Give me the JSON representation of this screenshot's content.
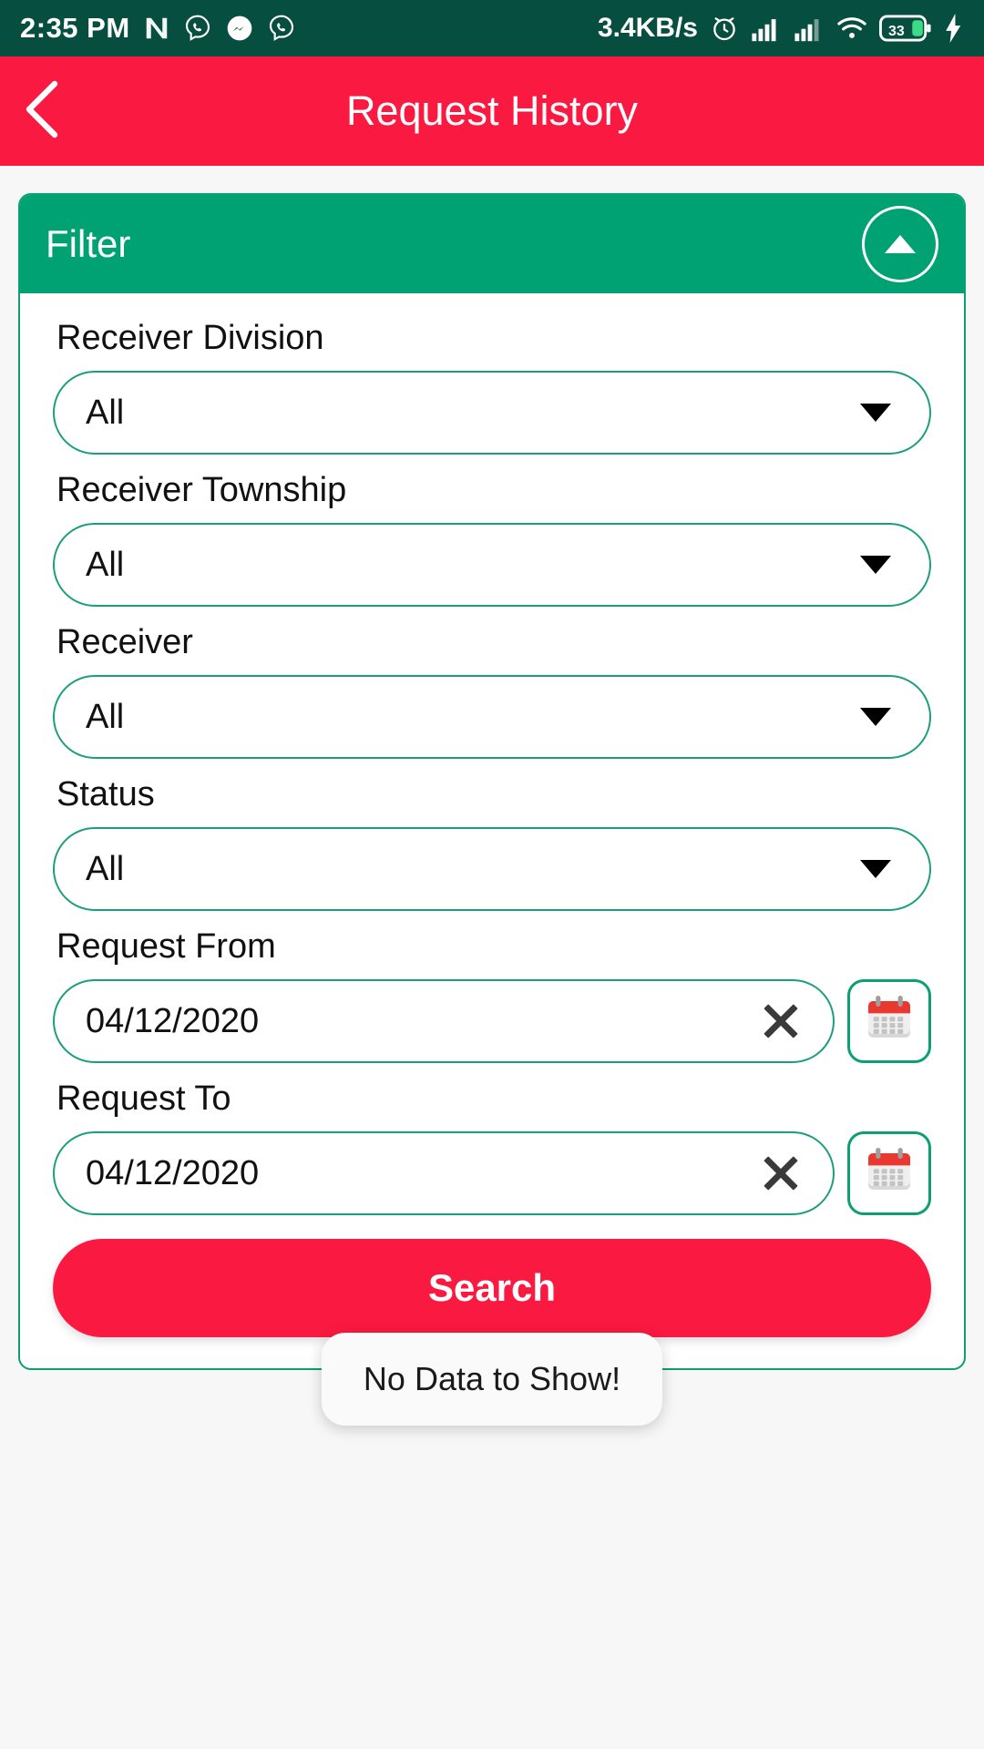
{
  "statusbar": {
    "time": "2:35 PM",
    "network_speed": "3.4KB/s",
    "battery_level": "33",
    "icons": [
      "nova-launcher-icon",
      "viber-icon",
      "messenger-icon",
      "viber-icon",
      "alarm-icon",
      "signal-icon",
      "signal-icon",
      "wifi-icon",
      "battery-icon",
      "charging-bolt-icon"
    ]
  },
  "appbar": {
    "title": "Request History",
    "back_icon": "chevron-left-icon"
  },
  "filter_card": {
    "header_title": "Filter",
    "collapse_icon": "chevron-up-icon",
    "fields": [
      {
        "label": "Receiver Division",
        "value": "All",
        "type": "select"
      },
      {
        "label": "Receiver Township",
        "value": "All",
        "type": "select"
      },
      {
        "label": "Receiver",
        "value": "All",
        "type": "select"
      },
      {
        "label": "Status",
        "value": "All",
        "type": "select"
      },
      {
        "label": "Request From",
        "value": "04/12/2020",
        "type": "date"
      },
      {
        "label": "Request To",
        "value": "04/12/2020",
        "type": "date"
      }
    ],
    "search_label": "Search"
  },
  "toast": {
    "message": "No Data to Show!"
  },
  "colors": {
    "accent_red": "#fa1940",
    "accent_green": "#00a173",
    "statusbar_green": "#064e3f",
    "border_green": "#1b9e7d"
  }
}
